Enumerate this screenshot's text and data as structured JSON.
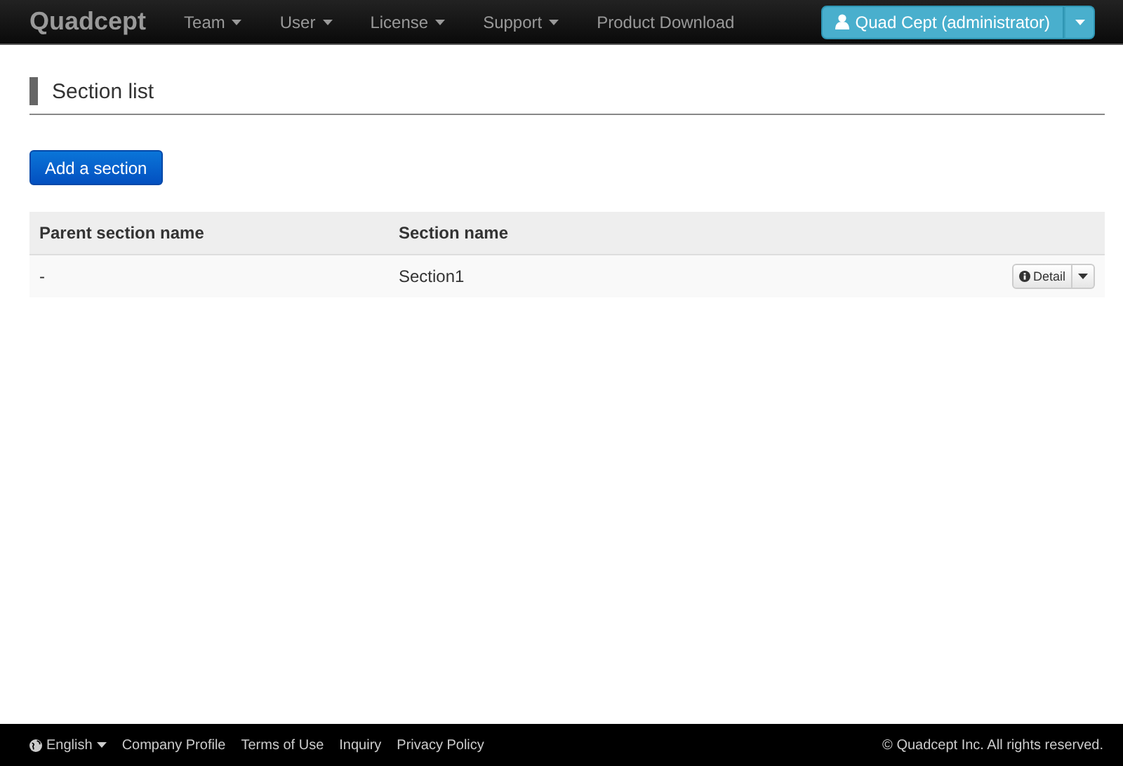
{
  "navbar": {
    "brand": "Quadcept",
    "menus": [
      {
        "label": "Team",
        "dropdown": true
      },
      {
        "label": "User",
        "dropdown": true
      },
      {
        "label": "License",
        "dropdown": true
      },
      {
        "label": "Support",
        "dropdown": true
      },
      {
        "label": "Product Download",
        "dropdown": false
      }
    ],
    "user_button": "Quad Cept (administrator)"
  },
  "page_title": "Section list",
  "add_button": "Add a section",
  "table": {
    "columns": [
      "Parent section name",
      "Section name"
    ],
    "rows": [
      {
        "cells": [
          "-",
          "Section1"
        ],
        "action": "Detail"
      }
    ]
  },
  "footer": {
    "language": "English",
    "links": [
      "Company Profile",
      "Terms of Use",
      "Inquiry",
      "Privacy Policy"
    ],
    "copyright": "© Quadcept Inc. All rights reserved."
  }
}
